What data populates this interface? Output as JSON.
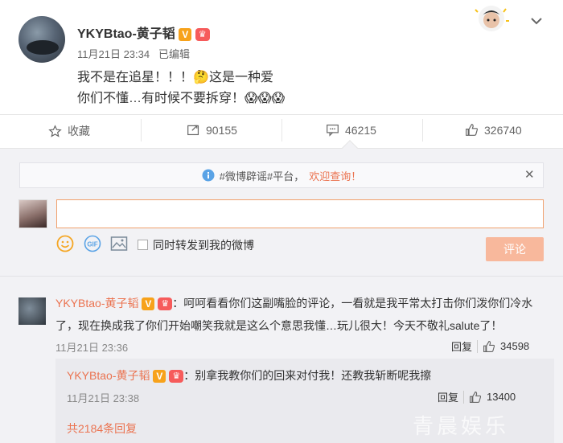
{
  "post": {
    "username": "YKYBtao-黄子韬",
    "v_badge": "V",
    "crown_badge": "♛",
    "timestamp": "11月21日 23:34",
    "edited": "已编辑",
    "line1_a": "我不是在追星！！！",
    "emoji1": "🤔",
    "line1_b": "这是一种爱",
    "line2": "你们不懂…有时候不要拆穿！",
    "emoji2": "😱😱😱"
  },
  "actions": {
    "favorite": "收藏",
    "repost": "90155",
    "comment": "46215",
    "like": "326740"
  },
  "notice": {
    "prefix": "#微博辟谣#平台，",
    "highlight": "欢迎查询！"
  },
  "composer": {
    "placeholder": "",
    "repost_label": "同时转发到我的微博",
    "submit": "评论"
  },
  "comment": {
    "username": "YKYBtao-黄子韬",
    "text_line1": "：呵呵看看你们这副嘴脸的评论，一看就是我平常太打击你们泼你们冷水",
    "text_line2": "了，现在换成我了你们开始嘲笑我就是这么个意思我懂…玩儿很大！今天不敬礼salute了！",
    "time": "11月21日 23:36",
    "reply": "回复",
    "likes": "34598"
  },
  "subcomment": {
    "username": "YKYBtao-黄子韬",
    "text": "：别拿我教你们的回来对付我！还教我斩断呢我擦",
    "time": "11月21日 23:38",
    "reply": "回复",
    "likes": "13400",
    "total_replies": "共2184条回复"
  },
  "watermark": "青晨娱乐",
  "colors": {
    "accent": "#eb7350",
    "badge_v": "#f7a21b",
    "panel_bg": "#f2f2f5"
  }
}
